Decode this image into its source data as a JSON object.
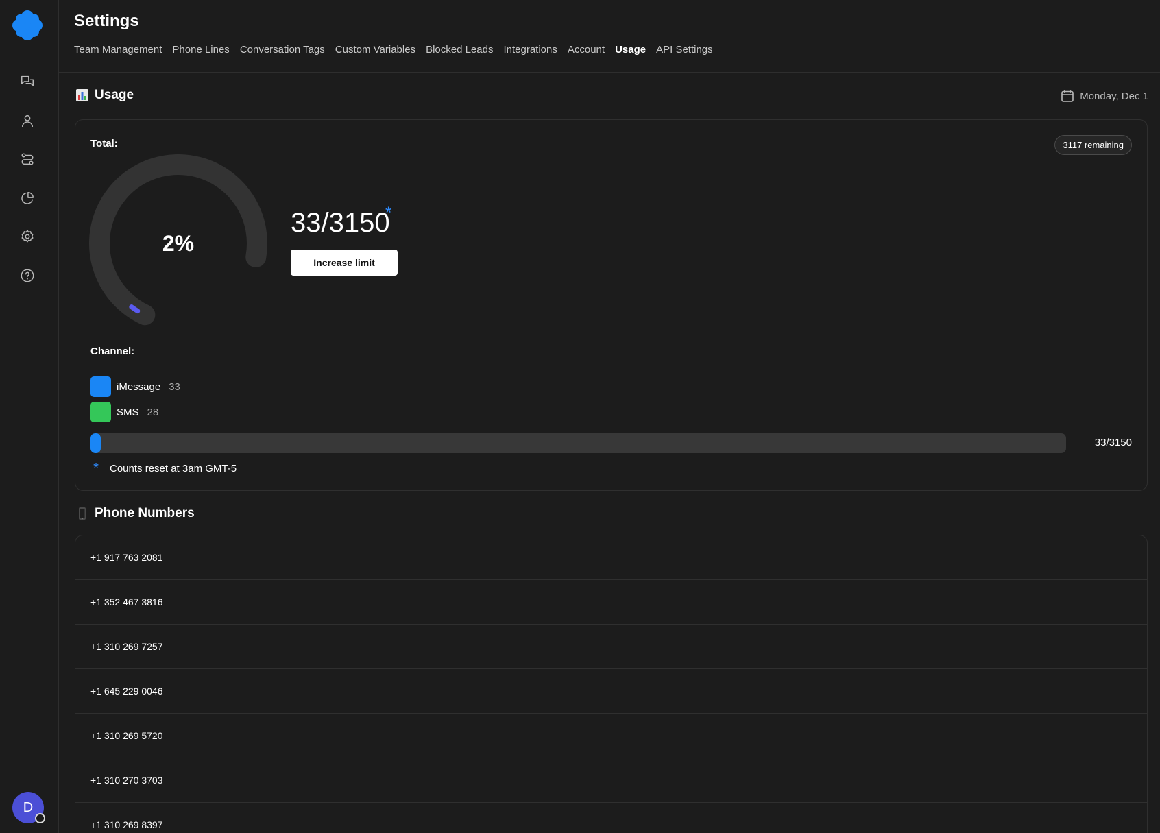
{
  "sidebar": {
    "logo": "flower-logo",
    "items": [
      {
        "name": "conversations",
        "icon": "chat-bubbles-icon"
      },
      {
        "name": "contacts",
        "icon": "person-icon"
      },
      {
        "name": "workflows",
        "icon": "route-icon"
      },
      {
        "name": "analytics",
        "icon": "pie-chart-icon"
      },
      {
        "name": "settings",
        "icon": "gear-icon"
      },
      {
        "name": "help",
        "icon": "help-circle-icon"
      }
    ],
    "avatar_initial": "D"
  },
  "header": {
    "title": "Settings",
    "tabs": [
      {
        "label": "Team Management",
        "active": false
      },
      {
        "label": "Phone Lines",
        "active": false
      },
      {
        "label": "Conversation Tags",
        "active": false
      },
      {
        "label": "Custom Variables",
        "active": false
      },
      {
        "label": "Blocked Leads",
        "active": false
      },
      {
        "label": "Integrations",
        "active": false
      },
      {
        "label": "Account",
        "active": false
      },
      {
        "label": "Usage",
        "active": true
      },
      {
        "label": "API Settings",
        "active": false
      }
    ]
  },
  "usage": {
    "heading": "Usage",
    "heading_icon": "bar-chart-icon",
    "date": "Monday, Dec 1",
    "date_icon": "calendar-icon",
    "total_label": "Total:",
    "remaining": "3117 remaining",
    "percent_text": "2%",
    "used_fraction": 0.02,
    "count_text": "33/3150",
    "asterisk": "*",
    "increase_button": "Increase limit",
    "channel_label": "Channel:",
    "channels": [
      {
        "name": "iMessage",
        "count": "33",
        "color": "#1a86f5"
      },
      {
        "name": "SMS",
        "count": "28",
        "color": "#34c759"
      }
    ],
    "progress_fraction": 0.0105,
    "progress_text": "33/3150",
    "reset_note": "Counts reset at 3am GMT-5"
  },
  "phone_numbers": {
    "heading": "Phone Numbers",
    "heading_icon": "mobile-phone-icon",
    "numbers": [
      "+1 917 763 2081",
      "+1 352 467 3816",
      "+1 310 269 7257",
      "+1 645 229 0046",
      "+1 310 269 5720",
      "+1 310 270 3703",
      "+1 310 269 8397"
    ]
  },
  "colors": {
    "accent_blue": "#1a86f5",
    "gauge_indicator": "#5b5bf0",
    "gauge_track": "#333333",
    "sms_green": "#34c759",
    "avatar": "#4b4fd6"
  }
}
